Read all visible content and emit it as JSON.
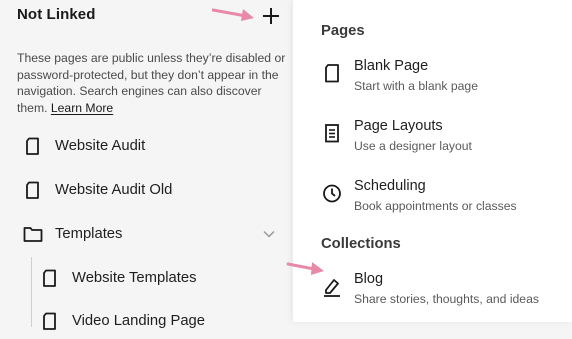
{
  "left_panel": {
    "title": "Not Linked",
    "description": "These pages are public unless they’re disabled or password-protected, but they don’t appear in the navigation. Search engines can also discover them.",
    "learn_more": "Learn More",
    "items": [
      {
        "label": "Website Audit",
        "icon": "page-icon"
      },
      {
        "label": "Website Audit Old",
        "icon": "page-icon"
      },
      {
        "label": "Templates",
        "icon": "folder-icon",
        "expanded": true
      },
      {
        "label": "Website Templates",
        "icon": "page-icon"
      },
      {
        "label": "Video Landing Page",
        "icon": "page-icon"
      }
    ]
  },
  "right_panel": {
    "pages_heading": "Pages",
    "pages": [
      {
        "title": "Blank Page",
        "subtitle": "Start with a blank page",
        "icon": "blank-page-icon"
      },
      {
        "title": "Page Layouts",
        "subtitle": "Use a designer layout",
        "icon": "layouts-icon"
      },
      {
        "title": "Scheduling",
        "subtitle": "Book appointments or classes",
        "icon": "clock-icon"
      }
    ],
    "collections_heading": "Collections",
    "collections": [
      {
        "title": "Blog",
        "subtitle": "Share stories, thoughts, and ideas",
        "icon": "blog-pen-icon"
      }
    ]
  },
  "colors": {
    "annotation_arrow": "#e889a8",
    "panel_bg": "#f5f5f5",
    "menu_bg": "#ffffff"
  }
}
